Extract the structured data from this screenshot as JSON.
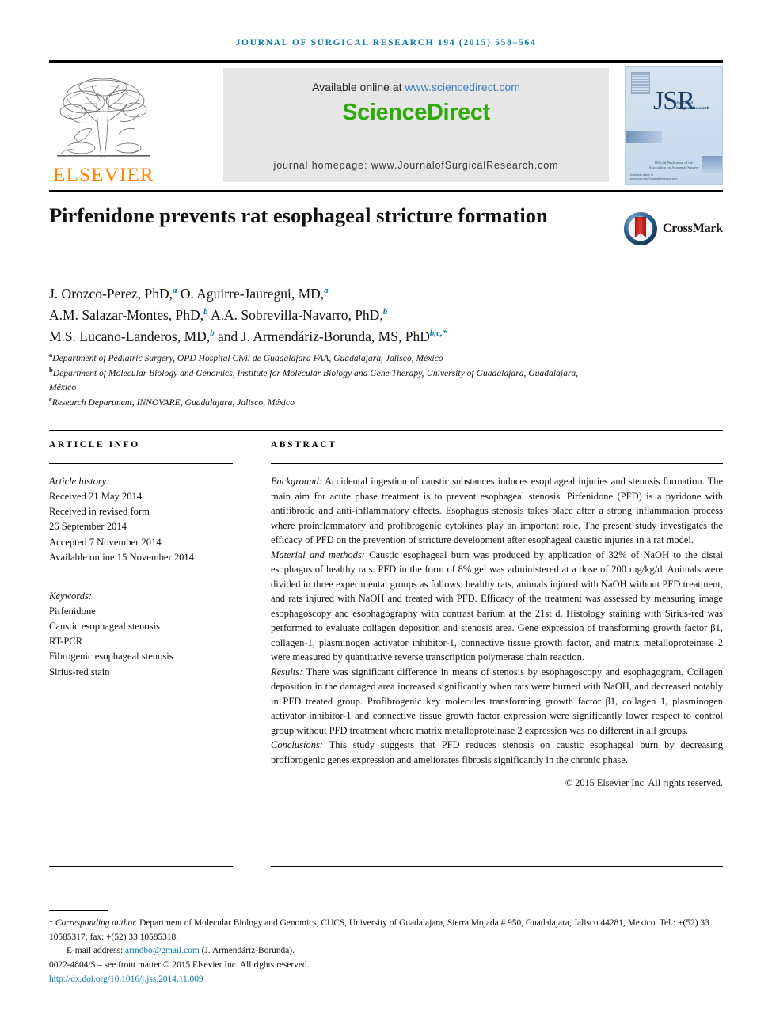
{
  "running_head": "Journal of Surgical Research 194 (2015) 558–564",
  "masthead": {
    "publisher_name": "ELSEVIER",
    "available_prefix": "Available online at ",
    "available_url": "www.sciencedirect.com",
    "platform_logo": "ScienceDirect",
    "homepage_line": "journal homepage: www.JournalofSurgicalResearch.com",
    "cover": {
      "acronym": "JSR",
      "subtitle_line1": "Journal of",
      "subtitle_line2": "Surgical Research",
      "official_line1": "Official Publication of the",
      "official_line2": "Association for Academic Surgery",
      "footer_line1": "Available online at",
      "footer_line2": "www.JournalofSurgicalResearch.com"
    },
    "colors": {
      "elsevier_orange": "#ff8200",
      "sciencedirect_green": "#30a90c",
      "link_blue": "#3a82c4",
      "accent_blue": "#0a7ba8",
      "band_gray": "#e6e6e6"
    }
  },
  "article": {
    "title": "Pirfenidone prevents rat esophageal stricture formation",
    "crossmark_label": "CrossMark",
    "authors_html": "J. Orozco-Perez, PhD,<sup>a</sup> O. Aguirre-Jauregui, MD,<sup>a</sup><br>A.M. Salazar-Montes, PhD,<sup>b</sup> A.A. Sobrevilla-Navarro, PhD,<sup>b</sup><br>M.S. Lucano-Landeros, MD,<sup>b</sup> and J. Armendáriz-Borunda, MS, PhD<sup>b,c,*</sup>",
    "affiliations_html": "<sup>a</sup>Department of Pediatric Surgery, OPD Hospital Civil de Guadalajara FAA, Guadalajara, Jalisco, México<br><sup>b</sup>Department of Molecular Biology and Genomics, Institute for Molecular Biology and Gene Therapy, University of Guadalajara, Guadalajara, México<br><sup>c</sup>Research Department, INNOVARE, Guadalajara, Jalisco, México"
  },
  "article_info": {
    "heading": "ARTICLE INFO",
    "history_label": "Article history:",
    "history": [
      "Received 21 May 2014",
      "Received in revised form",
      "26 September 2014",
      "Accepted 7 November 2014",
      "Available online 15 November 2014"
    ],
    "keywords_label": "Keywords:",
    "keywords": [
      "Pirfenidone",
      "Caustic esophageal stenosis",
      "RT-PCR",
      "Fibrogenic esophageal stenosis",
      "Sirius-red stain"
    ]
  },
  "abstract": {
    "heading": "ABSTRACT",
    "sections": [
      {
        "label": "Background:",
        "text": " Accidental ingestion of caustic substances induces esophageal injuries and stenosis formation. The main aim for acute phase treatment is to prevent esophageal stenosis. Pirfenidone (PFD) is a pyridone with antifibrotic and anti-inflammatory effects. Esophagus stenosis takes place after a strong inflammation process where proinflammatory and profibrogenic cytokines play an important role. The present study investigates the efficacy of PFD on the prevention of stricture development after esophageal caustic injuries in a rat model."
      },
      {
        "label": "Material and methods:",
        "text": " Caustic esophageal burn was produced by application of 32% of NaOH to the distal esophagus of healthy rats. PFD in the form of 8% gel was administered at a dose of 200 mg/kg/d. Animals were divided in three experimental groups as follows: healthy rats, animals injured with NaOH without PFD treatment, and rats injured with NaOH and treated with PFD. Efficacy of the treatment was assessed by measuring image esophagoscopy and esophagography with contrast barium at the 21st d. Histology staining with Sirius-red was performed to evaluate collagen deposition and stenosis area. Gene expression of transforming growth factor β1, collagen-1, plasminogen activator inhibitor-1, connective tissue growth factor, and matrix metalloproteinase 2 were measured by quantitative reverse transcription polymerase chain reaction."
      },
      {
        "label": "Results:",
        "text": " There was significant difference in means of stenosis by esophagoscopy and esophagogram. Collagen deposition in the damaged area increased significantly when rats were burned with NaOH, and decreased notably in PFD treated group. Profibrogenic key molecules transforming growth factor β1, collagen 1, plasminogen activator inhibitor-1 and connective tissue growth factor expression were significantly lower respect to control group without PFD treatment where matrix metalloproteinase 2 expression was no different in all groups."
      },
      {
        "label": "Conclusions:",
        "text": " This study suggests that PFD reduces stenosis on caustic esophageal burn by decreasing profibrogenic genes expression and ameliorates fibrosis significantly in the chronic phase."
      }
    ],
    "copyright": "© 2015 Elsevier Inc. All rights reserved."
  },
  "footer": {
    "corresponding_marker": "*",
    "corresponding_text": "Corresponding author.",
    "corresponding_address": " Department of Molecular Biology and Genomics, CUCS, University of Guadalajara, Sierra Mojada # 950, Guadalajara, Jalisco 44281, Mexico. Tel.: +(52) 33 10585317; fax: +(52) 33 10585318.",
    "email_label": "E-mail address: ",
    "email": "armdbo@gmail.com",
    "email_owner": " (J. Armendáriz-Borunda).",
    "issn_line": "0022-4804/$ – see front matter © 2015 Elsevier Inc. All rights reserved.",
    "doi": "http://dx.doi.org/10.1016/j.jss.2014.11.009"
  }
}
